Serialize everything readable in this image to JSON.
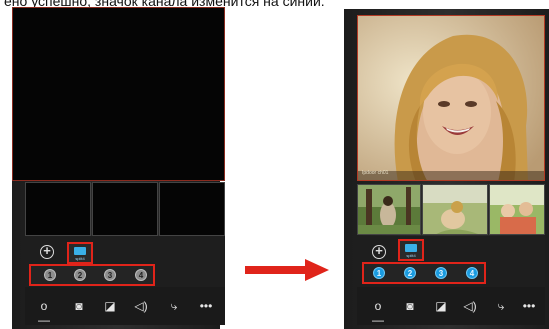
{
  "caption": "ено успешно, значок канала изменится на синий.",
  "controls": {
    "add_symbol": "+",
    "split_label": "split4",
    "channels": [
      "1",
      "2",
      "3",
      "4"
    ]
  },
  "toolbar": {
    "icons": [
      "key-icon",
      "camera-icon",
      "video-record-icon",
      "speaker-icon",
      "phone-hangup-icon",
      "more-icon"
    ],
    "glyphs": [
      "o—",
      "◙",
      "◪",
      "◁)",
      "⤷",
      "•••"
    ]
  },
  "right_phone": {
    "video_caption": "Ipdoor ch01"
  },
  "colors": {
    "highlight_red": "#e0241a",
    "channel_grey": "#8c8c8c",
    "channel_blue": "#1a9be0",
    "arrow_red": "#e0241a"
  },
  "state": {
    "left_channels": "grey",
    "right_channels": "blue"
  }
}
